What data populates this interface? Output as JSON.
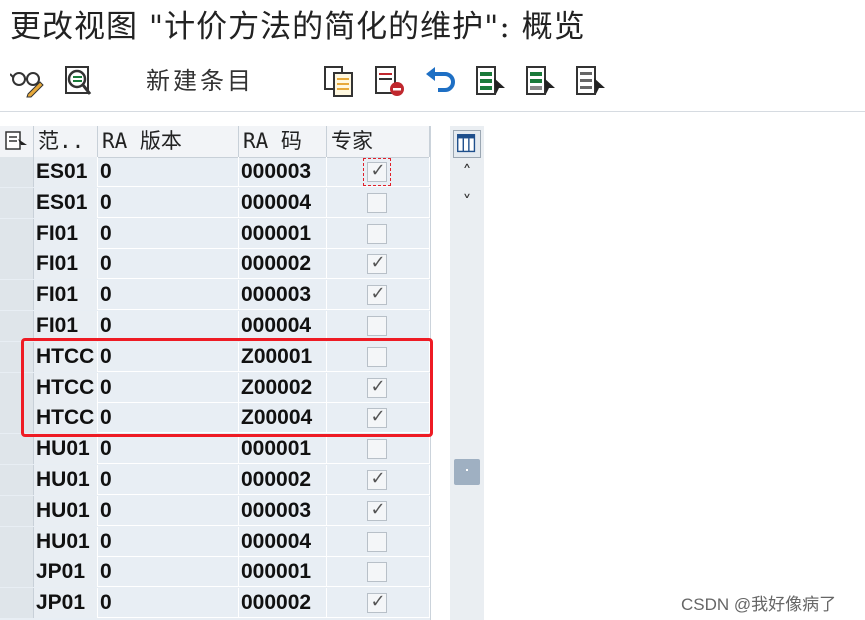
{
  "window": {
    "title": "更改视图 \"计价方法的简化的维护\": 概览"
  },
  "toolbar": {
    "new_entries_label": "新建条目",
    "icons": [
      "glasses-pencil-icon",
      "detail-search-icon",
      "copy-icon",
      "delete-icon",
      "undo-icon",
      "select-all-icon",
      "select-block-icon",
      "deselect-all-icon"
    ]
  },
  "table": {
    "columns": [
      "范..",
      "RA 版本",
      "RA 码",
      "专家"
    ],
    "rows": [
      {
        "scope": "ES01",
        "version": "0",
        "code": "000003",
        "expert": true
      },
      {
        "scope": "ES01",
        "version": "0",
        "code": "000004",
        "expert": false
      },
      {
        "scope": "FI01",
        "version": "0",
        "code": "000001",
        "expert": false
      },
      {
        "scope": "FI01",
        "version": "0",
        "code": "000002",
        "expert": true
      },
      {
        "scope": "FI01",
        "version": "0",
        "code": "000003",
        "expert": true
      },
      {
        "scope": "FI01",
        "version": "0",
        "code": "000004",
        "expert": false
      },
      {
        "scope": "HTCC",
        "version": "0",
        "code": "Z00001",
        "expert": false
      },
      {
        "scope": "HTCC",
        "version": "0",
        "code": "Z00002",
        "expert": true
      },
      {
        "scope": "HTCC",
        "version": "0",
        "code": "Z00004",
        "expert": true
      },
      {
        "scope": "HU01",
        "version": "0",
        "code": "000001",
        "expert": false
      },
      {
        "scope": "HU01",
        "version": "0",
        "code": "000002",
        "expert": true
      },
      {
        "scope": "HU01",
        "version": "0",
        "code": "000003",
        "expert": true
      },
      {
        "scope": "HU01",
        "version": "0",
        "code": "000004",
        "expert": false
      },
      {
        "scope": "JP01",
        "version": "0",
        "code": "000001",
        "expert": false
      },
      {
        "scope": "JP01",
        "version": "0",
        "code": "000002",
        "expert": true
      }
    ]
  },
  "scroll": {
    "up_glyph": "˄",
    "down_glyph": "˅"
  },
  "watermark": "CSDN @我好像病了",
  "colors": {
    "highlight": "#ee1b24",
    "table_bg": "#e8eef4",
    "toolbar_blue": "#1e6fc4",
    "toolbar_green": "#1a7a3a"
  }
}
